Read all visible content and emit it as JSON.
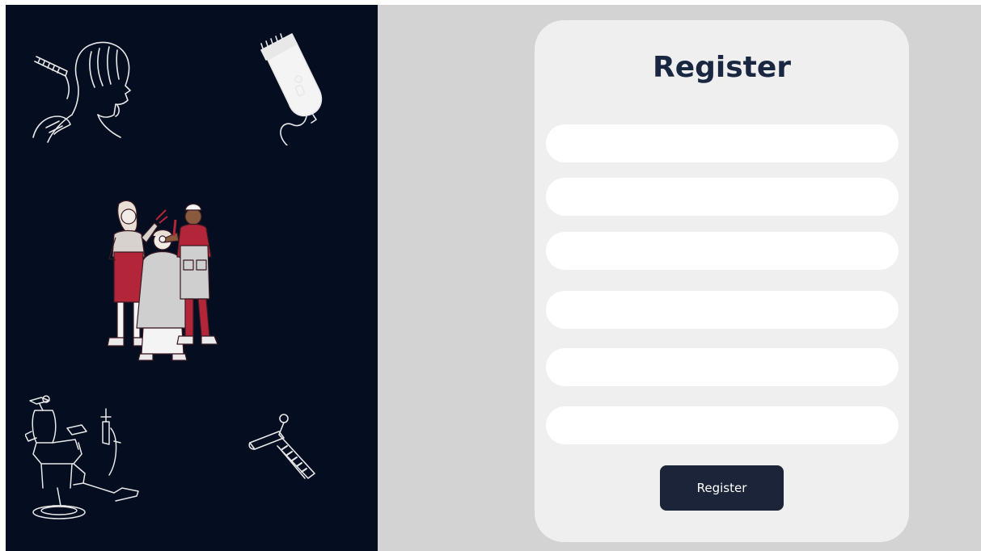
{
  "colors": {
    "left_panel_bg": "#040e20",
    "right_panel_bg": "#d3d3d3",
    "card_bg": "#efefef",
    "field_bg": "#ffffff",
    "button_bg": "#1b2438",
    "title_color": "#1a2740",
    "accent_red": "#b3263a"
  },
  "illustrations": [
    {
      "name": "hairdresser-haircut-illustration"
    },
    {
      "name": "hair-clipper-illustration"
    },
    {
      "name": "stylists-with-client-illustration"
    },
    {
      "name": "barber-chair-illustration"
    },
    {
      "name": "comb-and-clip-illustration"
    }
  ],
  "register": {
    "title": "Register",
    "fields": [
      {
        "name": "register-field-1",
        "value": "",
        "placeholder": ""
      },
      {
        "name": "register-field-2",
        "value": "",
        "placeholder": ""
      },
      {
        "name": "register-field-3",
        "value": "",
        "placeholder": ""
      },
      {
        "name": "register-field-4",
        "value": "",
        "placeholder": ""
      },
      {
        "name": "register-field-5",
        "value": "",
        "placeholder": ""
      },
      {
        "name": "register-field-6",
        "value": "",
        "placeholder": ""
      }
    ],
    "button_label": "Register"
  }
}
